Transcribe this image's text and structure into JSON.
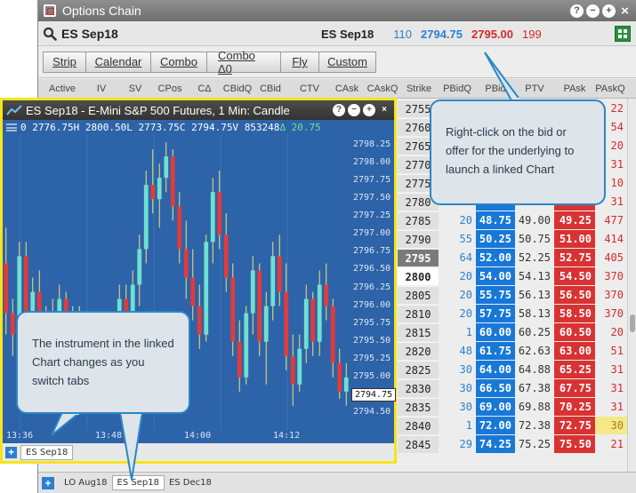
{
  "window": {
    "title": "Options Chain",
    "controls": [
      "?",
      "−",
      "+",
      "×"
    ]
  },
  "instrument": {
    "symbol": "ES Sep18",
    "quote_symbol": "ES Sep18",
    "bid_size": "110",
    "bid": "2794.75",
    "ask": "2795.00",
    "ask_size": "199"
  },
  "toolbar": {
    "buttons": [
      "Strip",
      "Calendar",
      "Combo",
      "Combo Δ0",
      "Fly",
      "Custom"
    ]
  },
  "columns": [
    "Active",
    "IV",
    "SV",
    "CPos",
    "CΔ",
    "CBidQ",
    "CBid",
    "CTV",
    "CAsk",
    "CAskQ",
    "Strike",
    "PBidQ",
    "PBid",
    "PTV",
    "PAsk",
    "PAskQ"
  ],
  "rows": [
    {
      "strike": "2755",
      "pbidq": "",
      "pbid": "",
      "ptv": "",
      "pask": "",
      "paskq": "22"
    },
    {
      "strike": "2760",
      "pbidq": "",
      "pbid": "",
      "ptv": "",
      "pask": "",
      "paskq": "54"
    },
    {
      "strike": "2765",
      "pbidq": "",
      "pbid": "",
      "ptv": "",
      "pask": "",
      "paskq": "20"
    },
    {
      "strike": "2770",
      "pbidq": "",
      "pbid": "",
      "ptv": "",
      "pask": "",
      "paskq": "31"
    },
    {
      "strike": "2775",
      "pbidq": "",
      "pbid": "",
      "ptv": "",
      "pask": "",
      "paskq": "10"
    },
    {
      "strike": "2780",
      "pbidq": "",
      "pbid": "",
      "ptv": "",
      "pask": "",
      "paskq": "31"
    },
    {
      "strike": "2785",
      "pbidq": "20",
      "pbid": "48.75",
      "ptv": "49.00",
      "pask": "49.25",
      "paskq": "477"
    },
    {
      "strike": "2790",
      "pbidq": "55",
      "pbid": "50.25",
      "ptv": "50.75",
      "pask": "51.00",
      "paskq": "414"
    },
    {
      "strike": "2795",
      "pbidq": "64",
      "pbid": "52.00",
      "ptv": "52.25",
      "pask": "52.75",
      "paskq": "405"
    },
    {
      "strike": "2800",
      "pbidq": "20",
      "pbid": "54.00",
      "ptv": "54.13",
      "pask": "54.50",
      "paskq": "370"
    },
    {
      "strike": "2805",
      "pbidq": "20",
      "pbid": "55.75",
      "ptv": "56.13",
      "pask": "56.50",
      "paskq": "370"
    },
    {
      "strike": "2810",
      "pbidq": "20",
      "pbid": "57.75",
      "ptv": "58.13",
      "pask": "58.50",
      "paskq": "370"
    },
    {
      "strike": "2815",
      "pbidq": "1",
      "pbid": "60.00",
      "ptv": "60.25",
      "pask": "60.50",
      "paskq": "20"
    },
    {
      "strike": "2820",
      "pbidq": "48",
      "pbid": "61.75",
      "ptv": "62.63",
      "pask": "63.00",
      "paskq": "51"
    },
    {
      "strike": "2825",
      "pbidq": "30",
      "pbid": "64.00",
      "ptv": "64.88",
      "pask": "65.25",
      "paskq": "31"
    },
    {
      "strike": "2830",
      "pbidq": "30",
      "pbid": "66.50",
      "ptv": "67.38",
      "pask": "67.75",
      "paskq": "31"
    },
    {
      "strike": "2835",
      "pbidq": "30",
      "pbid": "69.00",
      "ptv": "69.88",
      "pask": "70.25",
      "paskq": "31"
    },
    {
      "strike": "2840",
      "pbidq": "1",
      "pbid": "72.00",
      "ptv": "72.38",
      "pask": "72.75",
      "paskq": "30"
    },
    {
      "strike": "2845",
      "pbidq": "29",
      "pbid": "74.25",
      "ptv": "75.25",
      "pask": "75.50",
      "paskq": "21"
    }
  ],
  "bottom_tabs": [
    "LO Aug18",
    "ES Sep18",
    "ES Dec18"
  ],
  "chart_window": {
    "title": "ES Sep18 - E-Mini S&P 500 Futures, 1 Min: Candle",
    "ohlc_prefix": "0",
    "open": "2776.75H",
    "high": "2800.50L",
    "low": "2773.75C",
    "close": "2794.75V",
    "volume": "853248",
    "change": "Δ 20.75",
    "current_price": "2794.75",
    "tab": "ES Sep18"
  },
  "chart_data": {
    "type": "candlestick",
    "y_ticks": [
      "2798.25",
      "2798.00",
      "2797.75",
      "2797.50",
      "2797.25",
      "2797.00",
      "2796.75",
      "2796.50",
      "2796.25",
      "2796.00",
      "2795.75",
      "2795.50",
      "2795.25",
      "2795.00",
      "2794.50"
    ],
    "ylim": [
      2794.25,
      2798.4
    ],
    "x_ticks": [
      "13:36",
      "13:48",
      "14:00",
      "14:12"
    ],
    "candles": [
      [
        2796.6,
        2797.1,
        2795.6,
        2795.9
      ],
      [
        2795.9,
        2796.1,
        2795.3,
        2795.6
      ],
      [
        2795.6,
        2796.9,
        2795.4,
        2796.7
      ],
      [
        2796.7,
        2796.9,
        2795.6,
        2795.8
      ],
      [
        2795.8,
        2796.4,
        2795.5,
        2796.2
      ],
      [
        2796.2,
        2796.5,
        2795.3,
        2795.5
      ],
      [
        2795.5,
        2796.0,
        2795.2,
        2795.9
      ],
      [
        2795.9,
        2796.1,
        2795.1,
        2795.4
      ],
      [
        2795.4,
        2796.3,
        2795.2,
        2796.1
      ],
      [
        2796.1,
        2796.2,
        2795.0,
        2795.3
      ],
      [
        2795.3,
        2796.0,
        2795.1,
        2795.8
      ],
      [
        2795.8,
        2796.0,
        2795.0,
        2795.2
      ],
      [
        2795.2,
        2795.9,
        2795.0,
        2795.7
      ],
      [
        2795.7,
        2795.9,
        2794.9,
        2795.1
      ],
      [
        2795.1,
        2795.6,
        2794.9,
        2795.5
      ],
      [
        2795.5,
        2795.6,
        2794.8,
        2795.0
      ],
      [
        2795.0,
        2795.9,
        2794.9,
        2795.8
      ],
      [
        2795.8,
        2796.3,
        2795.5,
        2796.1
      ],
      [
        2796.1,
        2796.3,
        2795.4,
        2795.6
      ],
      [
        2795.6,
        2796.5,
        2795.4,
        2796.3
      ],
      [
        2796.3,
        2797.0,
        2796.0,
        2796.8
      ],
      [
        2796.8,
        2797.9,
        2796.6,
        2797.7
      ],
      [
        2797.7,
        2798.2,
        2797.3,
        2797.5
      ],
      [
        2797.5,
        2798.0,
        2797.1,
        2797.8
      ],
      [
        2797.8,
        2798.3,
        2797.6,
        2798.1
      ],
      [
        2798.1,
        2798.2,
        2797.2,
        2797.4
      ],
      [
        2797.4,
        2797.6,
        2796.6,
        2796.8
      ],
      [
        2796.8,
        2797.2,
        2796.1,
        2796.4
      ],
      [
        2796.4,
        2796.8,
        2795.8,
        2796.0
      ],
      [
        2796.0,
        2796.3,
        2795.4,
        2795.6
      ],
      [
        2795.6,
        2797.0,
        2795.5,
        2796.9
      ],
      [
        2796.9,
        2797.8,
        2796.6,
        2797.6
      ],
      [
        2797.6,
        2797.9,
        2796.8,
        2797.0
      ],
      [
        2797.0,
        2797.3,
        2796.2,
        2796.4
      ],
      [
        2796.4,
        2796.6,
        2795.3,
        2795.5
      ],
      [
        2795.5,
        2795.8,
        2794.8,
        2795.0
      ],
      [
        2795.0,
        2796.0,
        2794.9,
        2795.9
      ],
      [
        2795.9,
        2796.7,
        2795.6,
        2796.5
      ],
      [
        2796.5,
        2796.6,
        2795.3,
        2795.5
      ],
      [
        2795.5,
        2796.2,
        2794.9,
        2796.0
      ],
      [
        2796.0,
        2796.9,
        2795.8,
        2796.7
      ],
      [
        2796.7,
        2797.0,
        2796.0,
        2796.2
      ],
      [
        2796.2,
        2796.6,
        2795.1,
        2795.3
      ],
      [
        2795.3,
        2795.6,
        2794.6,
        2794.9
      ],
      [
        2794.9,
        2795.6,
        2794.8,
        2795.4
      ],
      [
        2795.4,
        2796.3,
        2795.2,
        2796.1
      ],
      [
        2796.1,
        2796.2,
        2795.3,
        2795.5
      ],
      [
        2795.5,
        2796.5,
        2795.3,
        2796.3
      ],
      [
        2796.3,
        2796.6,
        2795.8,
        2796.0
      ],
      [
        2796.0,
        2796.1,
        2795.0,
        2795.2
      ],
      [
        2795.2,
        2795.4,
        2794.7,
        2794.8
      ],
      [
        2794.8,
        2795.2,
        2794.6,
        2795.0
      ]
    ],
    "up_color": "#6fe0d0",
    "down_color": "#e23b3b"
  },
  "callouts": {
    "underlying": "Right-click on the bid or offer for the underlying to launch a linked Chart",
    "instrument": "The instrument in the linked Chart changes as you switch tabs"
  },
  "colors": {
    "bid_blue": "#1878d8",
    "ask_red": "#d93232",
    "chart_bg": "#2d63a8",
    "highlight_border": "#f5e51a",
    "callout_border": "#2a87c6"
  }
}
